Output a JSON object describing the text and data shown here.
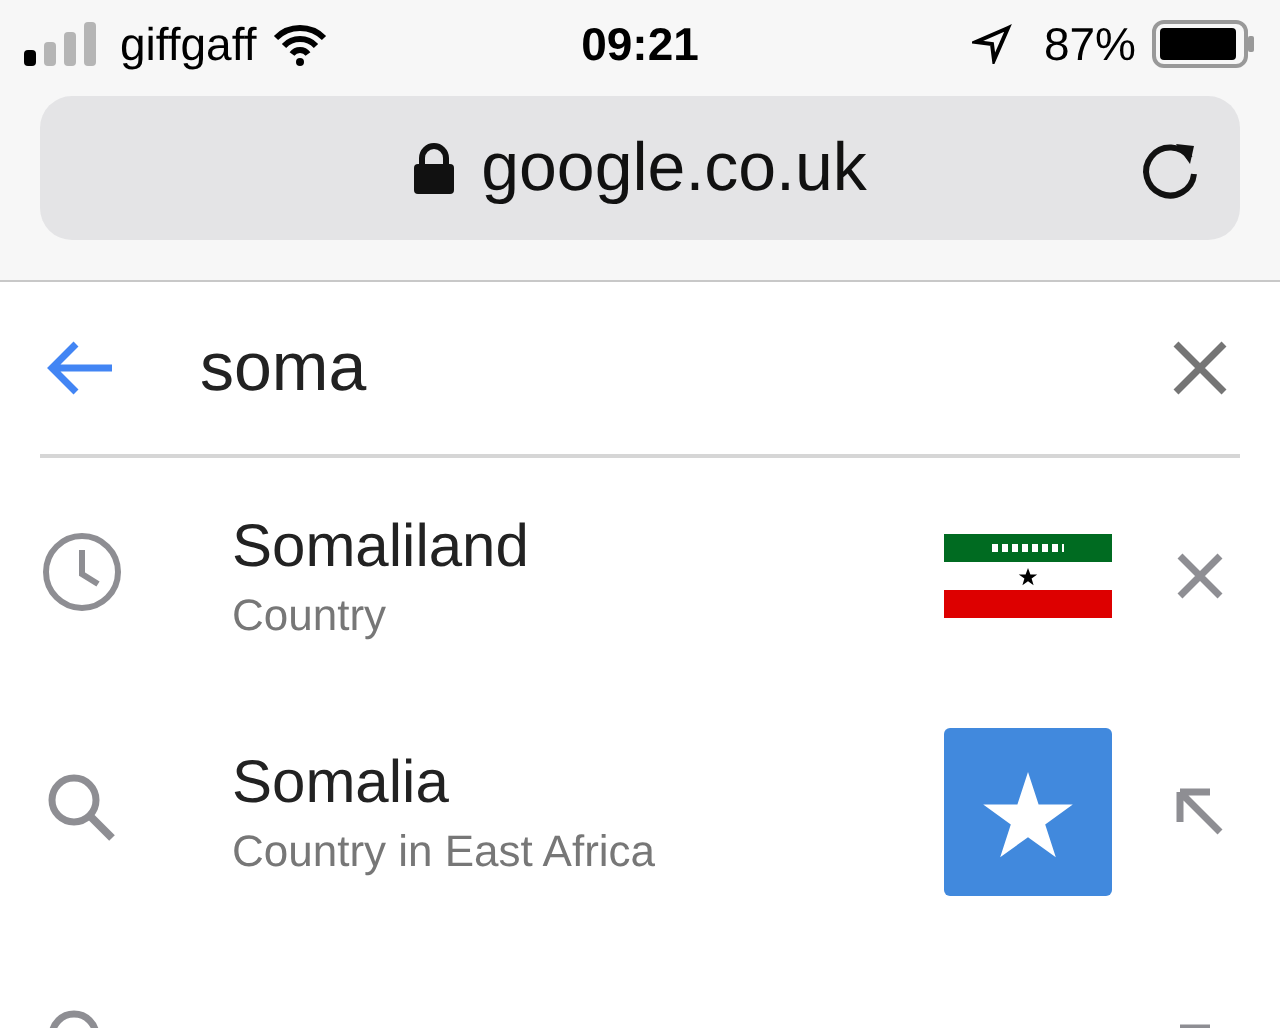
{
  "status_bar": {
    "carrier": "giffgaff",
    "time": "09:21",
    "battery": "87%"
  },
  "address_bar": {
    "url": "google.co.uk"
  },
  "search": {
    "value": "soma"
  },
  "suggestions": [
    {
      "kind": "history",
      "title": "Somaliland",
      "subtitle": "Country",
      "thumb": {
        "kind": "flag"
      },
      "action": {
        "kind": "remove"
      }
    },
    {
      "kind": "search",
      "title": "Somalia",
      "subtitle": "Country in East Africa",
      "thumb": {
        "kind": "star"
      },
      "action": {
        "kind": "fill"
      }
    },
    {
      "kind": "search",
      "action": {
        "kind": "fill"
      }
    }
  ]
}
